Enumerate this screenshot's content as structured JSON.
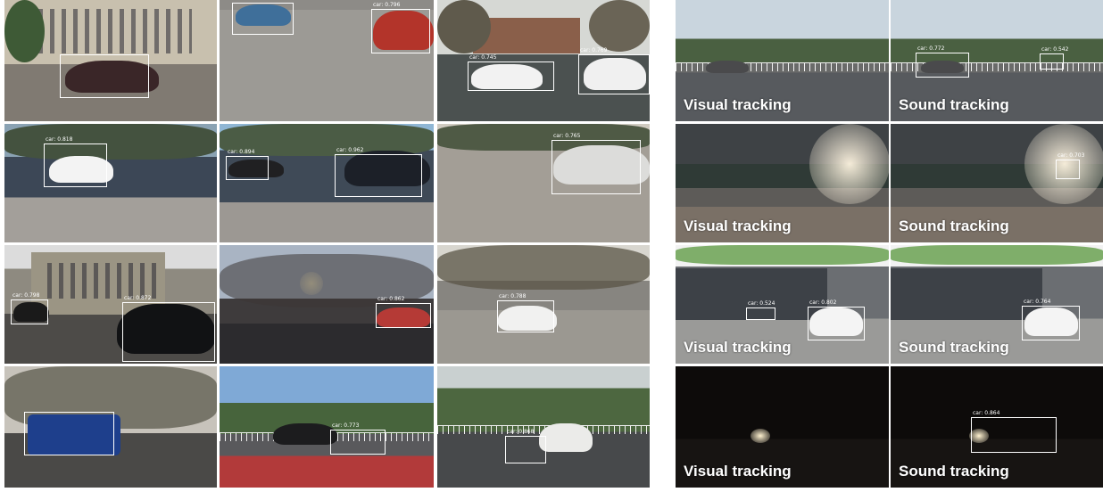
{
  "left_grid": {
    "rows": [
      {
        "tiles": [
          {
            "detections": [
              {
                "label": ""
              }
            ]
          },
          {
            "detections": [
              {
                "label": "car: 0.796"
              }
            ]
          },
          {
            "detections": [
              {
                "label": "car: 0.745"
              },
              {
                "label": "car: 0.769"
              }
            ]
          }
        ]
      },
      {
        "tiles": [
          {
            "detections": [
              {
                "label": "car: 0.818"
              }
            ]
          },
          {
            "detections": [
              {
                "label": "car: 0.894"
              },
              {
                "label": "car: 0.962"
              }
            ]
          },
          {
            "detections": [
              {
                "label": "car: 0.765"
              }
            ]
          }
        ]
      },
      {
        "tiles": [
          {
            "detections": [
              {
                "label": "car: 0.798"
              },
              {
                "label": "car: 0.872"
              }
            ]
          },
          {
            "detections": [
              {
                "label": "car: 0.862"
              }
            ]
          },
          {
            "detections": [
              {
                "label": "car: 0.788"
              }
            ]
          }
        ]
      },
      {
        "tiles": [
          {
            "detections": [
              {
                "label": ""
              }
            ]
          },
          {
            "detections": [
              {
                "label": "car: 0.773"
              }
            ]
          },
          {
            "detections": [
              {
                "label": "car: 0.868"
              }
            ]
          }
        ]
      }
    ]
  },
  "comparison": {
    "visual_caption": "Visual tracking",
    "sound_caption": "Sound tracking",
    "rows": [
      {
        "visual": {
          "detections": []
        },
        "sound": {
          "detections": [
            {
              "label": "car: 0.772"
            },
            {
              "label": "car: 0.542"
            }
          ]
        }
      },
      {
        "visual": {
          "detections": []
        },
        "sound": {
          "detections": [
            {
              "label": "car: 0.703"
            }
          ]
        }
      },
      {
        "visual": {
          "detections": [
            {
              "label": "car: 0.524"
            },
            {
              "label": "car: 0.802"
            }
          ]
        },
        "sound": {
          "detections": [
            {
              "label": "car: 0.764"
            }
          ]
        }
      },
      {
        "visual": {
          "detections": []
        },
        "sound": {
          "detections": [
            {
              "label": "car: 0.864"
            }
          ]
        }
      }
    ]
  },
  "colors": {
    "box": "#ffffff",
    "caption": "#ffffff"
  }
}
